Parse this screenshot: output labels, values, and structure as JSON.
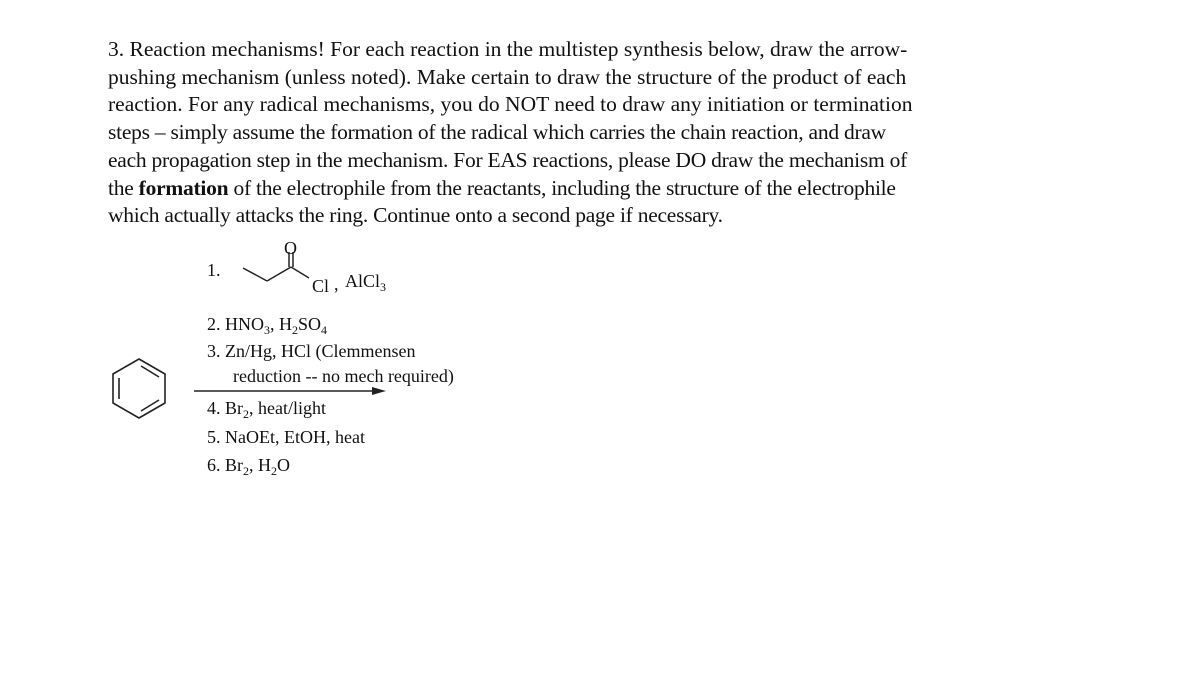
{
  "problem": {
    "lines": [
      "3.  Reaction mechanisms!  For each reaction in the multistep synthesis below, draw the arrow-",
      "pushing mechanism (unless noted).  Make certain to draw the structure of the product of each",
      "reaction.  For any radical mechanisms, you do NOT need to draw any initiation or termination",
      "steps – simply assume the formation of the radical which carries the chain reaction, and draw",
      "each propagation step in the mechanism.  For EAS reactions, please DO draw the mechanism of"
    ],
    "line6_pre": "the ",
    "line6_bold": "formation",
    "line6_post": " of the electrophile from the reactants, including the structure of the electrophile",
    "line7": "which actually attacks the ring.  Continue onto a second page if necessary."
  },
  "scheme": {
    "starting_material": "benzene",
    "step1": {
      "number": "1.",
      "reagent_structure": "propanoyl chloride",
      "carbonyl_O": "O",
      "Cl": "Cl",
      "sep": ",",
      "catalyst_main": "AlCl",
      "catalyst_sub": "3"
    },
    "step2": {
      "a": "2.  HNO",
      "a_sub": "3",
      "b": ", H",
      "b_sub": "2",
      "c": "SO",
      "c_sub": "4"
    },
    "step3_line1": "3.  Zn/Hg, HCl (Clemmensen",
    "step3_line2": "reduction -- no mech required)",
    "step4": {
      "a": "4.  Br",
      "a_sub": "2",
      "b": ", heat/light"
    },
    "step5": "5.  NaOEt, EtOH, heat",
    "step6": {
      "a": "6.  Br",
      "a_sub": "2",
      "b": ", H",
      "b_sub": "2",
      "c": "O"
    }
  }
}
